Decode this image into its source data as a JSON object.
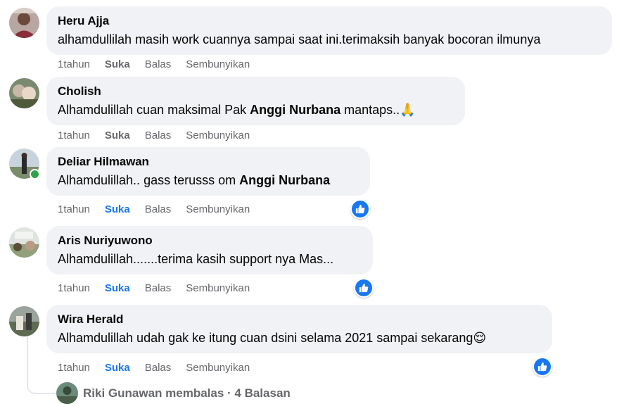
{
  "comments": [
    {
      "author": "Heru Ajja",
      "text": "alhamdullilah masih work cuannya sampai saat ini.terimaksih banyak bocoran ilmunya",
      "time": "1tahun",
      "like": "Suka",
      "reply": "Balas",
      "hide": "Sembunyikan",
      "liked": false
    },
    {
      "author": "Cholish",
      "text_pre": "Alhamdulillah cuan maksimal Pak ",
      "mention": "Anggi Nurbana",
      "text_post": " mantaps..",
      "emoji": "🙏",
      "time": "1tahun",
      "like": "Suka",
      "reply": "Balas",
      "hide": "Sembunyikan",
      "liked": false
    },
    {
      "author": "Deliar Hilmawan",
      "text_pre": "Alhamdulillah.. gass terusss om ",
      "mention": "Anggi Nurbana",
      "time": "1tahun",
      "like": "Suka",
      "reply": "Balas",
      "hide": "Sembunyikan",
      "liked": true,
      "online": true,
      "reaction": "like-icon"
    },
    {
      "author": "Aris Nuriyuwono",
      "text": "Alhamdulillah.......terima kasih support nya Mas...",
      "time": "1tahun",
      "like": "Suka",
      "reply": "Balas",
      "hide": "Sembunyikan",
      "liked": true,
      "reaction": "like-icon"
    },
    {
      "author": "Wira Herald",
      "text": "Alhamdulillah udah gak ke itung cuan dsini selama 2021 sampai sekarang",
      "emoji": "😌",
      "time": "1tahun",
      "like": "Suka",
      "reply": "Balas",
      "hide": "Sembunyikan",
      "liked": true,
      "reaction": "like-icon"
    }
  ],
  "replies": {
    "label": "Riki Gunawan membalas · 4 Balasan"
  },
  "colors": {
    "accent": "#1877f2",
    "bubble": "#f0f2f5",
    "meta": "#65676b",
    "online": "#31a24c"
  }
}
